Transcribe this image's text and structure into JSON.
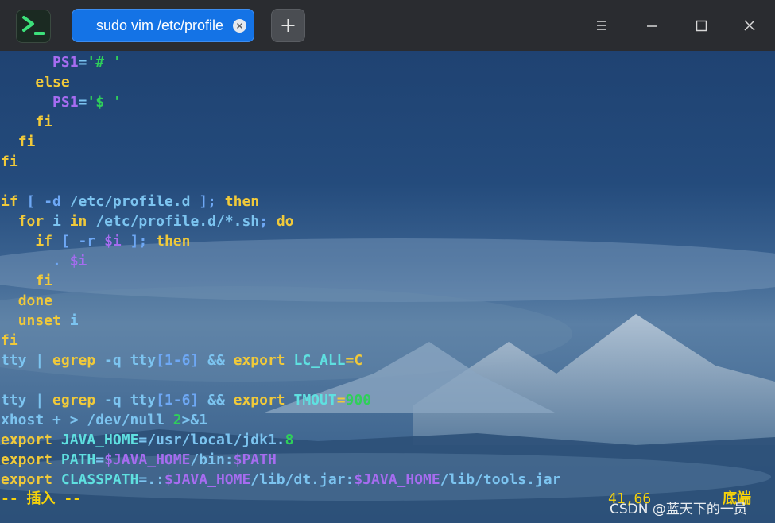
{
  "window": {
    "tab_title": "sudo vim /etc/profile",
    "icons": {
      "app": "terminal-app-icon",
      "tab_close": "close-icon",
      "new_tab": "plus-icon",
      "menu": "menu-icon",
      "minimize": "minimize-icon",
      "maximize": "maximize-icon",
      "close": "close-icon"
    }
  },
  "colors": {
    "keyword": "#6ea8f5",
    "path": "#c890e8",
    "variable": "#a66cf0",
    "string": "#c14ccf",
    "number": "#2fcf5a",
    "operator": "#f0c93a",
    "plain": "#7cc4f0",
    "cyan": "#5fe0e0",
    "status": "#f6d20a"
  },
  "editor": {
    "lines": [
      [
        {
          "t": "      ",
          "c": "plain"
        },
        {
          "t": "PS1",
          "c": "variable"
        },
        {
          "t": "=",
          "c": "plain"
        },
        {
          "t": "'# '",
          "c": "number"
        }
      ],
      [
        {
          "t": "    ",
          "c": "plain"
        },
        {
          "t": "else",
          "c": "operator"
        }
      ],
      [
        {
          "t": "      ",
          "c": "plain"
        },
        {
          "t": "PS1",
          "c": "variable"
        },
        {
          "t": "=",
          "c": "plain"
        },
        {
          "t": "'$ '",
          "c": "number"
        }
      ],
      [
        {
          "t": "    ",
          "c": "plain"
        },
        {
          "t": "fi",
          "c": "operator"
        }
      ],
      [
        {
          "t": "  ",
          "c": "plain"
        },
        {
          "t": "fi",
          "c": "operator"
        }
      ],
      [
        {
          "t": "fi",
          "c": "operator"
        }
      ],
      [
        {
          "t": "",
          "c": "plain"
        }
      ],
      [
        {
          "t": "if",
          "c": "operator"
        },
        {
          "t": " [ -d ",
          "c": "keyword"
        },
        {
          "t": "/etc/profile.d",
          "c": "plain"
        },
        {
          "t": " ]; ",
          "c": "keyword"
        },
        {
          "t": "then",
          "c": "operator"
        }
      ],
      [
        {
          "t": "  ",
          "c": "plain"
        },
        {
          "t": "for",
          "c": "operator"
        },
        {
          "t": " i ",
          "c": "plain"
        },
        {
          "t": "in",
          "c": "operator"
        },
        {
          "t": " /etc/profile.d/*.sh",
          "c": "plain"
        },
        {
          "t": "; ",
          "c": "keyword"
        },
        {
          "t": "do",
          "c": "operator"
        }
      ],
      [
        {
          "t": "    ",
          "c": "plain"
        },
        {
          "t": "if",
          "c": "operator"
        },
        {
          "t": " [ -r ",
          "c": "keyword"
        },
        {
          "t": "$i",
          "c": "variable"
        },
        {
          "t": " ]; ",
          "c": "keyword"
        },
        {
          "t": "then",
          "c": "operator"
        }
      ],
      [
        {
          "t": "      . ",
          "c": "keyword"
        },
        {
          "t": "$i",
          "c": "variable"
        }
      ],
      [
        {
          "t": "    ",
          "c": "plain"
        },
        {
          "t": "fi",
          "c": "operator"
        }
      ],
      [
        {
          "t": "  ",
          "c": "plain"
        },
        {
          "t": "done",
          "c": "operator"
        }
      ],
      [
        {
          "t": "  ",
          "c": "plain"
        },
        {
          "t": "unset",
          "c": "operator"
        },
        {
          "t": " i",
          "c": "plain"
        }
      ],
      [
        {
          "t": "fi",
          "c": "operator"
        }
      ],
      [
        {
          "t": "tty | ",
          "c": "plain"
        },
        {
          "t": "egrep",
          "c": "operator"
        },
        {
          "t": " -q tty",
          "c": "plain"
        },
        {
          "t": "[1-6]",
          "c": "keyword"
        },
        {
          "t": " && ",
          "c": "plain"
        },
        {
          "t": "export",
          "c": "operator"
        },
        {
          "t": " LC_ALL",
          "c": "cyan"
        },
        {
          "t": "=C",
          "c": "operator"
        }
      ],
      [
        {
          "t": "",
          "c": "plain"
        }
      ],
      [
        {
          "t": "tty | ",
          "c": "plain"
        },
        {
          "t": "egrep",
          "c": "operator"
        },
        {
          "t": " -q tty",
          "c": "plain"
        },
        {
          "t": "[1-6]",
          "c": "keyword"
        },
        {
          "t": " && ",
          "c": "plain"
        },
        {
          "t": "export",
          "c": "operator"
        },
        {
          "t": " TMOUT",
          "c": "cyan"
        },
        {
          "t": "=",
          "c": "operator"
        },
        {
          "t": "900",
          "c": "number"
        }
      ],
      [
        {
          "t": "xhost + > /dev/null ",
          "c": "plain"
        },
        {
          "t": "2",
          "c": "number"
        },
        {
          "t": ">&1",
          "c": "plain"
        }
      ],
      [
        {
          "t": "export",
          "c": "operator"
        },
        {
          "t": " JAVA_HOME",
          "c": "cyan"
        },
        {
          "t": "=/usr/local/jdk1.",
          "c": "plain"
        },
        {
          "t": "8",
          "c": "number"
        }
      ],
      [
        {
          "t": "export",
          "c": "operator"
        },
        {
          "t": " PATH",
          "c": "cyan"
        },
        {
          "t": "=",
          "c": "plain"
        },
        {
          "t": "$JAVA_HOME",
          "c": "variable"
        },
        {
          "t": "/bin:",
          "c": "plain"
        },
        {
          "t": "$PATH",
          "c": "variable"
        }
      ],
      [
        {
          "t": "export",
          "c": "operator"
        },
        {
          "t": " CLASSPATH",
          "c": "cyan"
        },
        {
          "t": "=.:",
          "c": "plain"
        },
        {
          "t": "$JAVA_HOME",
          "c": "variable"
        },
        {
          "t": "/lib/dt.jar:",
          "c": "plain"
        },
        {
          "t": "$JAVA_HOME",
          "c": "variable"
        },
        {
          "t": "/lib/tools.jar",
          "c": "plain"
        }
      ]
    ],
    "mode": "-- 插入 --",
    "cursor_position": "41,66",
    "scroll_position": "底端"
  },
  "watermark": "CSDN @蓝天下的一员"
}
